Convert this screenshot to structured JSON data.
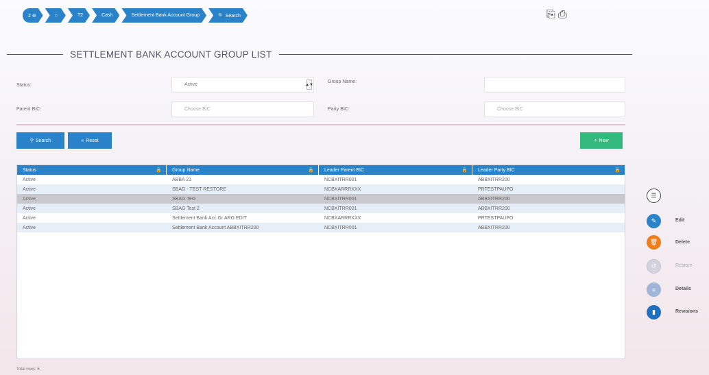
{
  "breadcrumb": {
    "items": [
      {
        "label": "2 ⊕"
      },
      {
        "label": "⌂"
      },
      {
        "label": "T2"
      },
      {
        "label": "Cash"
      },
      {
        "label": "Settlement Bank Account Group"
      },
      {
        "label": "🔍 Search"
      }
    ]
  },
  "page": {
    "title": "SETTLEMENT BANK ACCOUNT GROUP LIST"
  },
  "form": {
    "status_label": "Status:",
    "status_value": "Active",
    "group_name_label": "Group Name:",
    "group_name_value": "",
    "parent_bic_label": "Parent BIC:",
    "parent_bic_placeholder": "Choose BIC",
    "party_bic_label": "Party BIC:",
    "party_bic_placeholder": "Choose BIC"
  },
  "buttons": {
    "search": "Search",
    "reset": "Reset",
    "new": "New"
  },
  "table": {
    "headers": [
      "Status",
      "Group Name",
      "Leader Parent BIC",
      "Leader Party BIC"
    ],
    "rows": [
      [
        "Active",
        "ABBA 21",
        "NCBXITRR001",
        "ABBXITRR200"
      ],
      [
        "Active",
        "SBAG - TEST RESTORE",
        "NCBXARRRXXX",
        "PRTESTPAUPO"
      ],
      [
        "Active",
        "SBAG Test",
        "NCBXITRR001",
        "ABBXITRR200"
      ],
      [
        "Active",
        "SBAG Test 2",
        "NCBXITRR001",
        "ABBXITRR200"
      ],
      [
        "Active",
        "Settlement Bank Acc Gr ARG EDIT",
        "NCBXARRRXXX",
        "PRTESTPAUPO"
      ],
      [
        "Active",
        "Settlement Bank Account ABBXITRR200",
        "NCBXITRR001",
        "ABBXITRR200"
      ]
    ],
    "total": "Total rows: 6"
  },
  "actions": {
    "edit": "Edit",
    "delete": "Delete",
    "restore": "Restore",
    "details": "Details",
    "revisions": "Revisions"
  },
  "colors": {
    "primary": "#2a83c8",
    "new_button": "#34b97d",
    "delete": "#ef7d1a",
    "disabled": "#c9cedc"
  }
}
